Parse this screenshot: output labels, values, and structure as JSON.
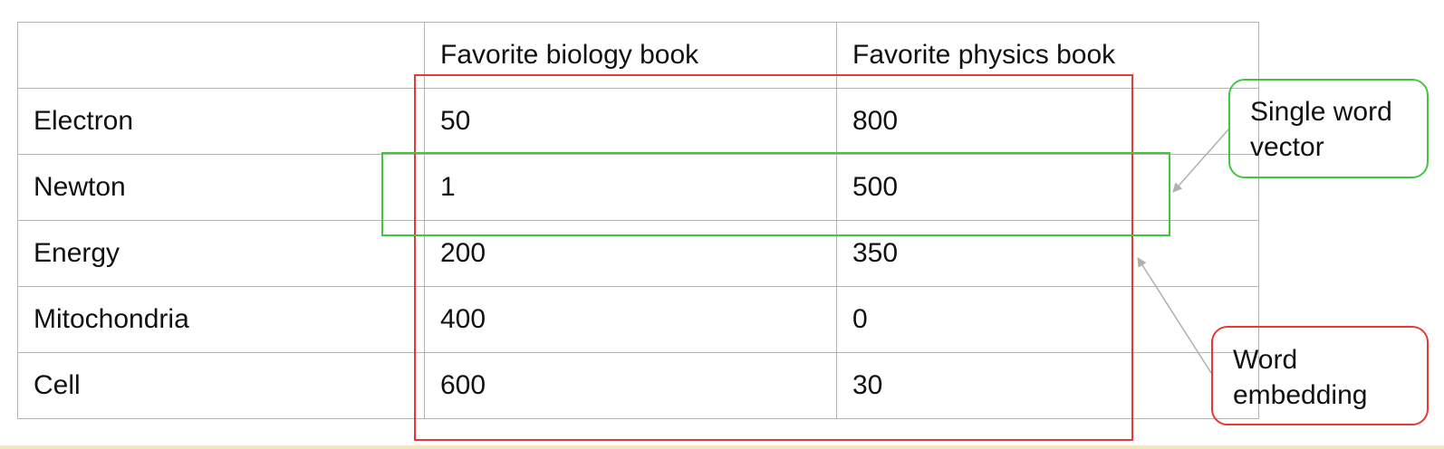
{
  "table": {
    "headers": [
      "",
      "Favorite biology book",
      "Favorite physics book"
    ],
    "rows": [
      {
        "label": "Electron",
        "biology": "50",
        "physics": "800"
      },
      {
        "label": "Newton",
        "biology": "1",
        "physics": "500"
      },
      {
        "label": "Energy",
        "biology": "200",
        "physics": "350"
      },
      {
        "label": "Mitochondria",
        "biology": "400",
        "physics": "0"
      },
      {
        "label": "Cell",
        "biology": "600",
        "physics": "30"
      }
    ]
  },
  "callouts": {
    "single_word_vector": {
      "line1": "Single word",
      "line2": "vector",
      "color": "#43c443"
    },
    "word_embedding": {
      "line1": "Word",
      "line2": "embedding",
      "color": "#e53935"
    }
  },
  "colors": {
    "grid_line": "#b3b3b3",
    "arrow": "#b0b0b0"
  }
}
